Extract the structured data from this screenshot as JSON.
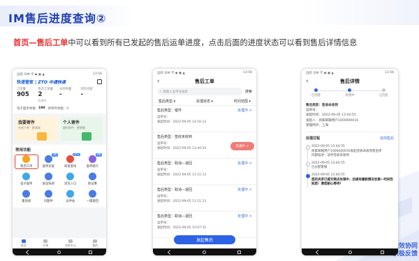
{
  "slide": {
    "title": "IM售后进度查询②",
    "desc_highlight": "首页—售后工单",
    "desc_rest": "中可以看到所有已发起的售后运单进度，点击后面的进度状态可以看到售后详情信息",
    "brand": [
      "高效协同",
      "积极反馈"
    ]
  },
  "phone1": {
    "status_left": "远有 SIM 卡 ◆ ▣ ▲",
    "status_right": "13:56",
    "brand_text": "快递管家",
    "logo_text": "ZTO 中通快递",
    "stats": [
      {
        "label": "订单量",
        "value": "905",
        "sub": ""
      },
      {
        "label": "售后工单量",
        "value": "2",
        "sub": "处理中"
      },
      {
        "label": "未到件量",
        "value": "-",
        "sub": ""
      },
      {
        "label": "到货待取",
        "value": "-",
        "sub": ""
      }
    ],
    "tip_label": "电子面单余额",
    "tip_value": "198",
    "tip_text": "待寄件余额：0",
    "card_left_title": "我要寄件",
    "card_left_desc": "在线下单 · 更高效",
    "card_right_title": "个人寄件",
    "card_right_desc": "随时寄件 · 更便捷",
    "common_title": "常用功能",
    "grid": [
      {
        "label": "售后工单",
        "badge": "",
        "color": "#f3a51c"
      },
      {
        "label": "面单充值",
        "badge": "领取",
        "color": "#4b7be5"
      },
      {
        "label": "研发查询",
        "badge": "NEW",
        "color": "#e94a3f"
      },
      {
        "label": "面单统计",
        "badge": "领取",
        "color": "#8a62dc"
      },
      {
        "label": "电子面单",
        "badge": "",
        "color": "#3fa7e8"
      },
      {
        "label": "协议快递",
        "badge": "",
        "color": "#4b7be5"
      },
      {
        "label": "退货入口",
        "badge": "",
        "color": "#3fa7e8"
      },
      {
        "label": "地址簿",
        "badge": "",
        "color": "#4b7be5"
      },
      {
        "label": "集快递",
        "badge": "",
        "color": "#4b7be5"
      },
      {
        "label": "问题件",
        "badge": "",
        "color": "#4b7be5"
      },
      {
        "label": "派件站",
        "badge": "",
        "color": "#3fa7e8"
      },
      {
        "label": "一键退回",
        "badge": "",
        "color": "#4b7be5"
      }
    ],
    "tabs": [
      "首页",
      "打单",
      "消息中心",
      "我的"
    ]
  },
  "phone2": {
    "status_left": "远有 SIM 卡 ◆ ▣ ▲",
    "status_right": "13:56",
    "title": "售后工单",
    "search_placeholder": "请输入运单号搜索",
    "search_btn": "搜索",
    "filters": [
      "售后类型 ▾",
      "处理状态 ▾",
      "时间范围 ▾"
    ],
    "tickets": [
      {
        "type": "售后类型：催件",
        "status": "处理中 >",
        "no": "运单号：",
        "time": "发起时间：2022-09-05 14:16:13"
      },
      {
        "type": "售后类型：签收未收到",
        "status": "处理中 >",
        "no": "运单号：",
        "time": "发起时间：2022-09-05 13:44:54"
      },
      {
        "type": "售后类型：取消—退回",
        "status": "处理中 >",
        "no": "运单号：",
        "time": "发起时间：2022-09-05 11:11:13"
      },
      {
        "type": "售后类型：取消—退回",
        "status": "处理中 >",
        "no": "运单号：",
        "time": "发起时间：2022-09-05 11:11:13"
      },
      {
        "type": "售后类型：取消—退回",
        "status": "处理中 >",
        "no": "运单号：",
        "time": "发起时间：2022-09-05 10:07:32"
      }
    ],
    "submit": "发起售后"
  },
  "phone3": {
    "status_left": "远有 SIM 卡 ◆ ▣ ▲",
    "status_right": "13:58",
    "title": "售后详情",
    "steps": [
      "已创建",
      "处理中",
      "已完结"
    ],
    "info": [
      "售后类型：签收未收到",
      "运单号：",
      "发起时间：2022-09-05 13:44:55",
      "发起人：商家邮箱用户1000000016",
      "受理网点：上海"
    ],
    "process_title": "处理过程",
    "process_link": "追加售后",
    "events": [
      "2022-09-05 13:44:55",
      "商家邮箱用户1000000016发起签收未收到售后单",
      "问题描述：该件签收未收到",
      "2022-09-05 13:44:55",
      "已分配客服",
      "2022-09-05 13:44:55",
      "您的诉求已提交网点处理中，后续有最新情况会第一时间告知您！请您耐心等待！"
    ]
  }
}
